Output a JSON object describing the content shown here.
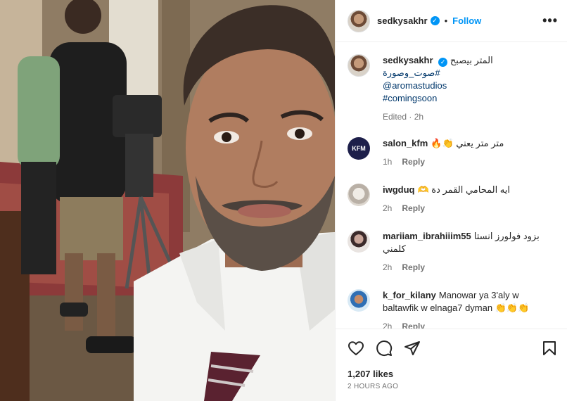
{
  "post": {
    "username": "sedkysakhr",
    "follow_label": "Follow",
    "separator": "•",
    "more_label": "•••"
  },
  "caption": {
    "username": "sedkysakhr",
    "text": "المتر بيصبح",
    "tags": [
      "#صوت_وصورة",
      "@aromastudios",
      "#comingsoon"
    ],
    "edited": "Edited · 2h"
  },
  "comments": [
    {
      "username": "salon_kfm",
      "text": "متر متر يعني 👏🔥",
      "time": "1h",
      "reply_label": "Reply",
      "avatar_text": "KFM"
    },
    {
      "username": "iwgduq",
      "text": "ايه المحامي القمر دة 🫶",
      "time": "2h",
      "reply_label": "Reply"
    },
    {
      "username": "mariiam_ibrahiiim55",
      "text": "بزود فولورز انستا كلمني",
      "time": "2h",
      "reply_label": "Reply"
    },
    {
      "username": "k_for_kilany",
      "text": "Manowar ya 3'aly w baltawfik w elnaga7 dyman 👏👏👏",
      "time": "2h",
      "reply_label": "Reply"
    }
  ],
  "footer": {
    "likes": "1,207 likes",
    "time_ago": "2 HOURS AGO"
  },
  "icons": {
    "like": "heart-icon",
    "comment": "comment-icon",
    "share": "paper-plane-icon",
    "save": "bookmark-icon",
    "verified": "verified-badge-icon"
  },
  "colors": {
    "accent": "#0095f6",
    "link": "#00376b",
    "muted": "#737373",
    "text": "#262626"
  }
}
